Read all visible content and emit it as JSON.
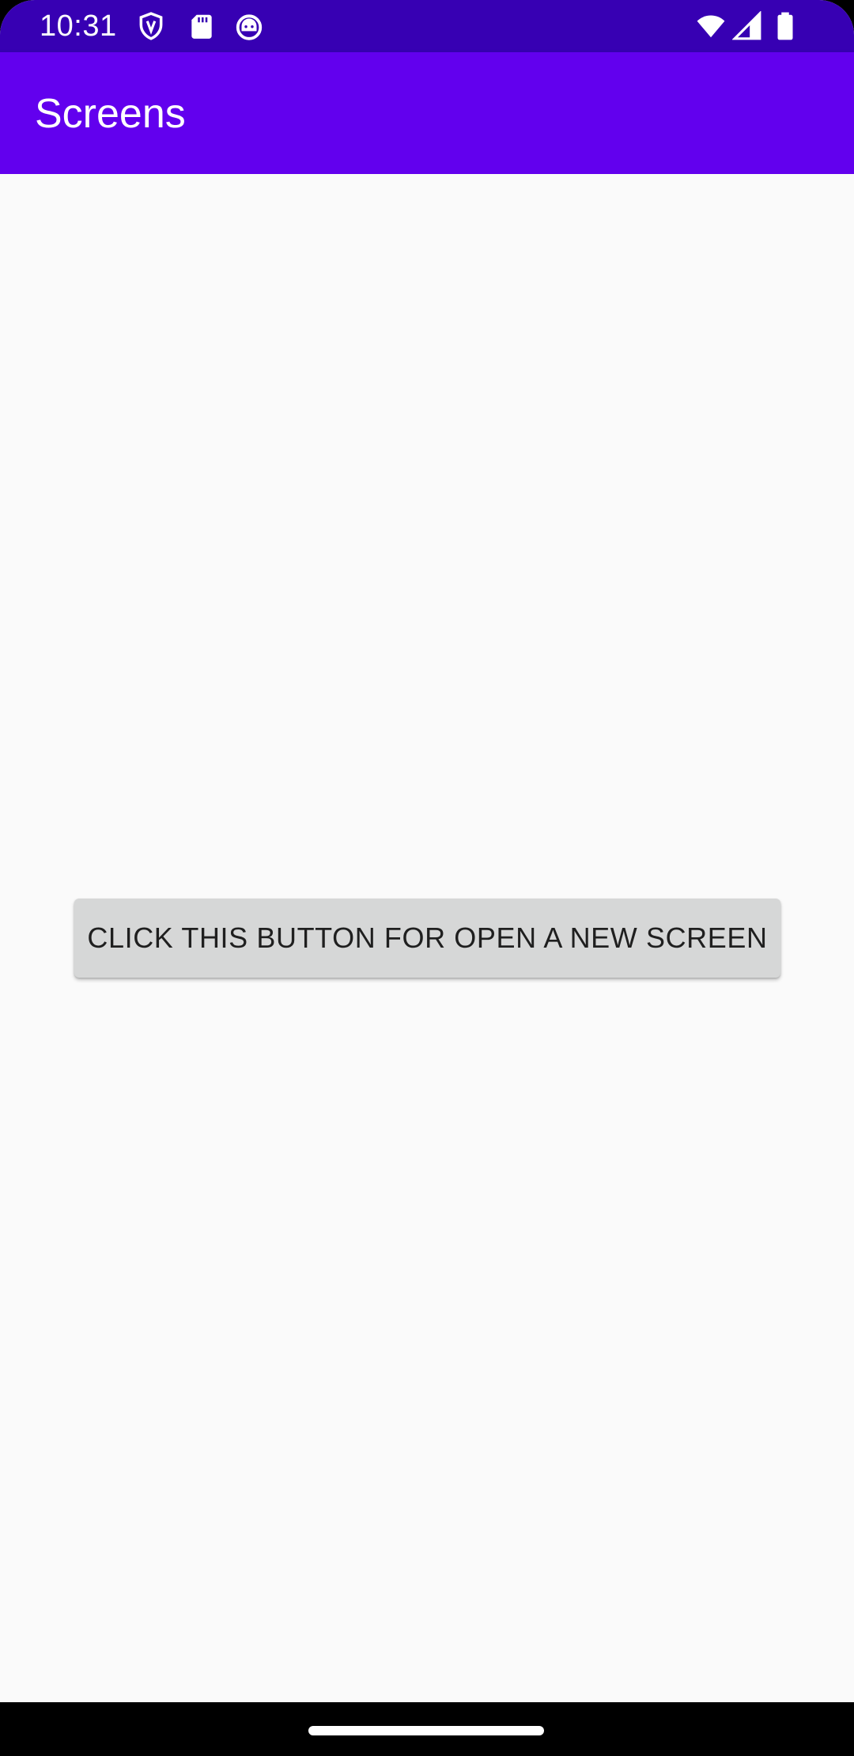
{
  "status_bar": {
    "time": "10:31",
    "icons_left": [
      "shield-icon",
      "sd-card-icon",
      "android-debug-icon"
    ],
    "icons_right": [
      "wifi-icon",
      "cell-signal-icon",
      "battery-icon"
    ],
    "background": "#3700b3"
  },
  "app_bar": {
    "title": "Screens",
    "background": "#6200ee"
  },
  "main": {
    "button_label": "CLICK THIS BUTTON FOR OPEN A NEW SCREEN",
    "button_color": "#d6d7d7",
    "background": "#fafafa"
  },
  "nav_bar": {
    "handle": "home-gesture-pill"
  }
}
